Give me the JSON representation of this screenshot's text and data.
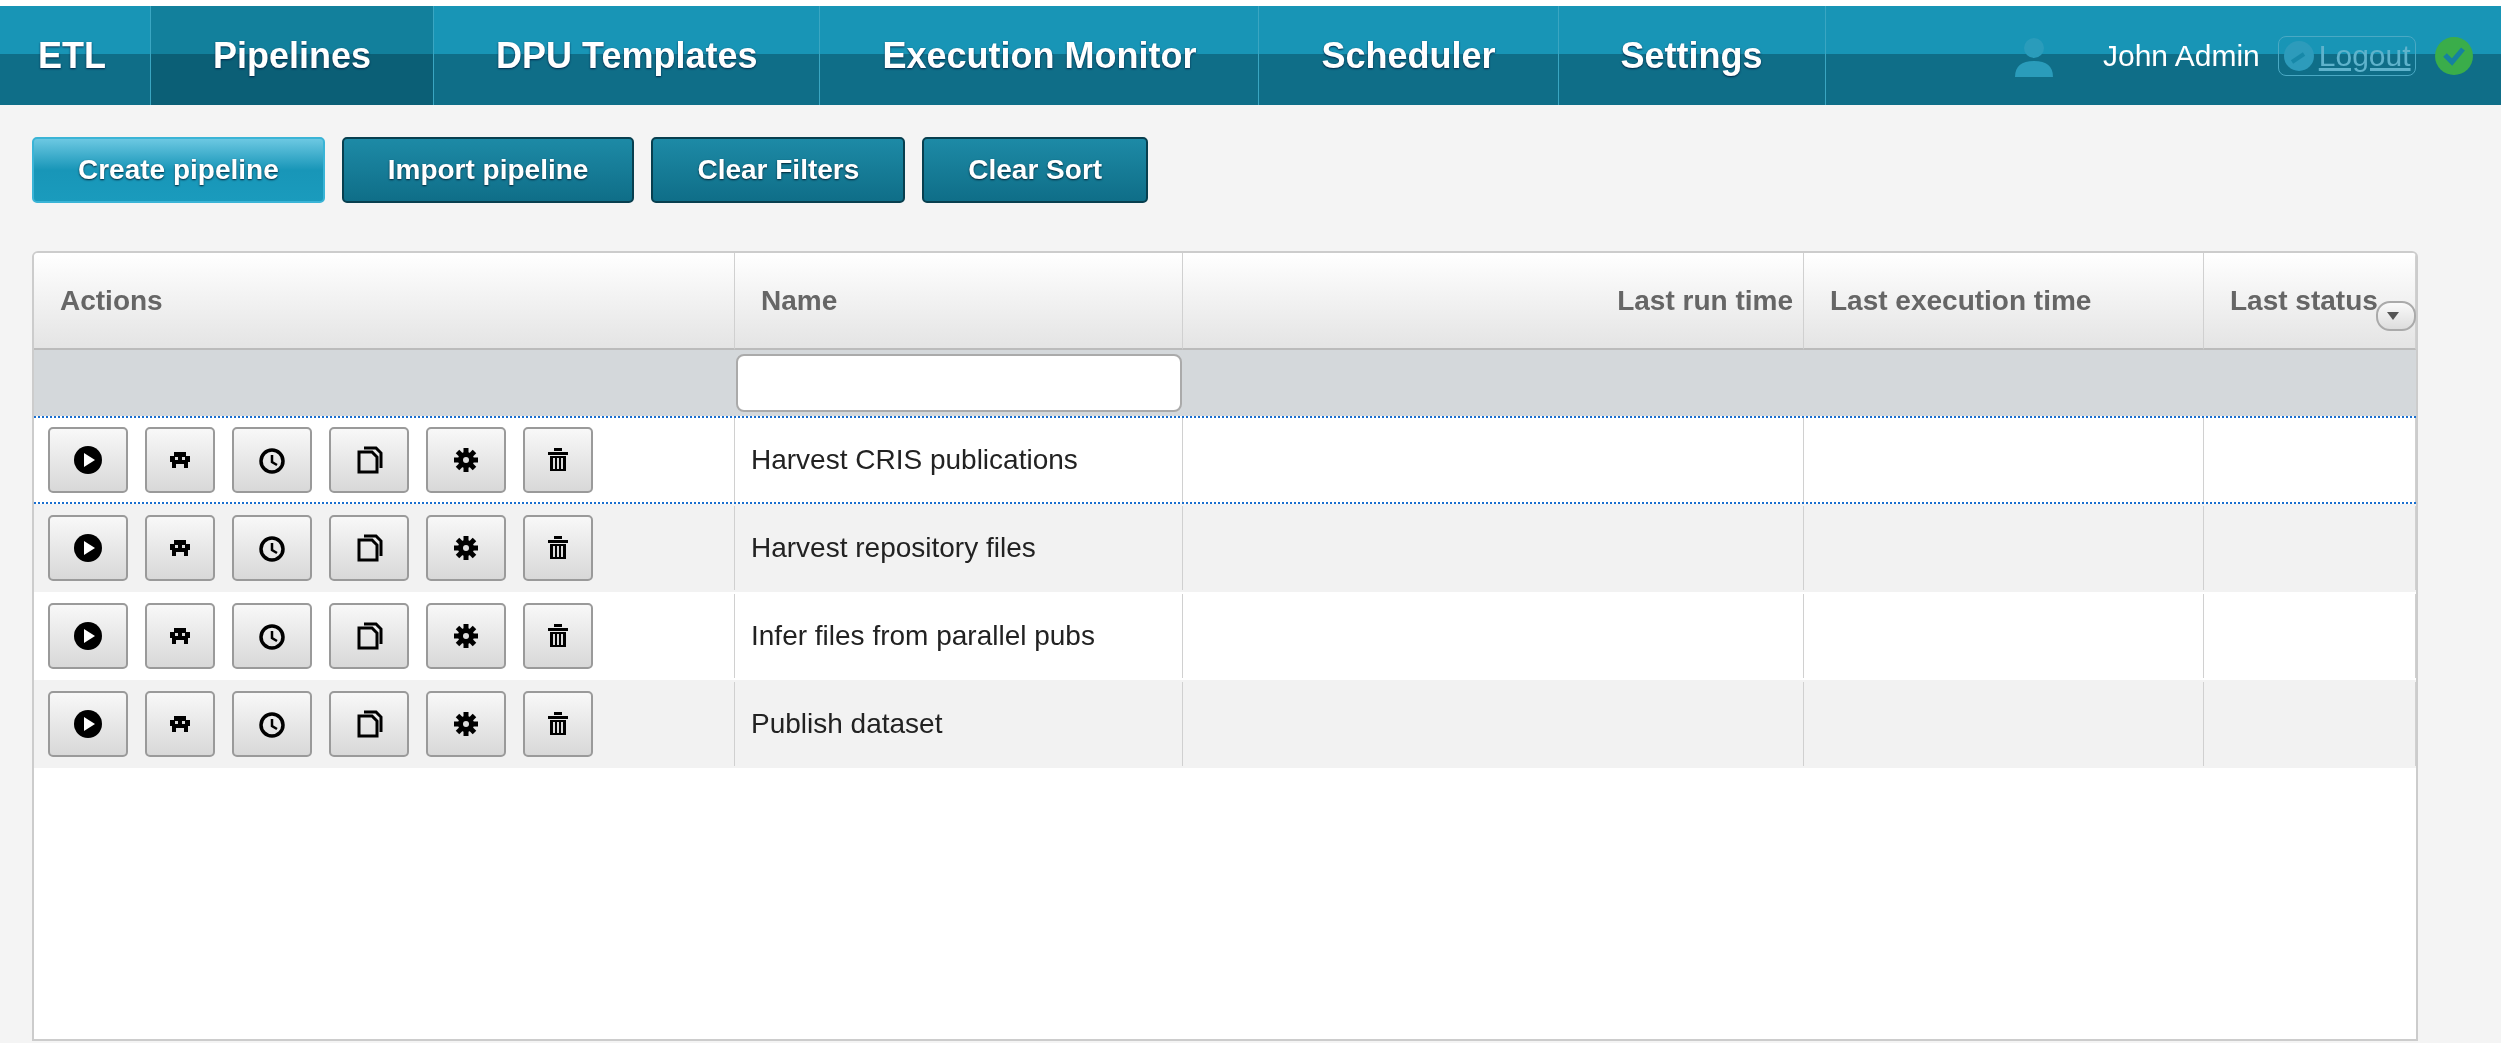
{
  "nav": {
    "items": [
      {
        "label": "ETL",
        "selected": false
      },
      {
        "label": "Pipelines",
        "selected": true
      },
      {
        "label": "DPU Templates",
        "selected": false
      },
      {
        "label": "Execution Monitor",
        "selected": false
      },
      {
        "label": "Scheduler",
        "selected": false
      },
      {
        "label": "Settings",
        "selected": false
      }
    ],
    "user": "John Admin",
    "logout": "Logout",
    "connected": true
  },
  "toolbar": [
    {
      "label": "Create pipeline",
      "focused": true
    },
    {
      "label": "Import pipeline",
      "focused": false
    },
    {
      "label": "Clear Filters",
      "focused": false
    },
    {
      "label": "Clear Sort",
      "focused": false
    }
  ],
  "table": {
    "columns": [
      "Actions",
      "Name",
      "Last run time",
      "Last execution time",
      "Last status"
    ],
    "rows": [
      {
        "name": "Harvest CRIS publications",
        "selected": true
      },
      {
        "name": "Harvest repository files",
        "selected": false
      },
      {
        "name": "Infer files from parallel pubs",
        "selected": false
      },
      {
        "name": "Publish dataset",
        "selected": false
      }
    ]
  }
}
